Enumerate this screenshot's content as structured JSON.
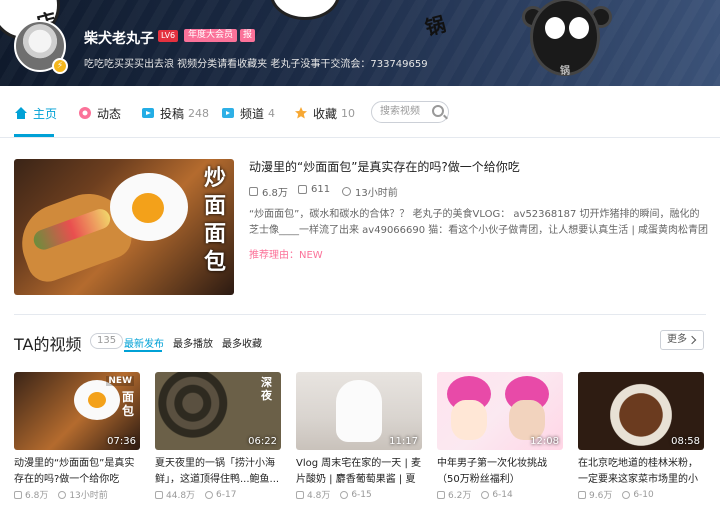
{
  "profile": {
    "username": "柴犬老丸子",
    "level": "LV6",
    "vip_badge": "年度大会员",
    "extra_badge": "报",
    "signature": "吃吃吃买买买出去浪 视频分类请看收藏夹 老丸子没事干交流会：733749659"
  },
  "banner": {
    "glyph_left": "店",
    "glyph_mid": "锅",
    "glyph_right": "锅"
  },
  "nav": {
    "home": "主页",
    "dynamic": "动态",
    "submissions": "投稿",
    "submissions_count": "248",
    "channels": "频道",
    "channels_count": "4",
    "favorites": "收藏",
    "favorites_count": "10",
    "search_placeholder": "搜索视频"
  },
  "featured": {
    "cover_text": "炒面面包",
    "title": "动漫里的“炒面面包”是真实存在的吗?做一个给你吃",
    "plays": "6.8万",
    "comments": "611",
    "time": "13小时前",
    "description": "“炒面面包”，碳水和碳水的合体？？ 老丸子的美食VLOG： av52368187 切开炸猪排的瞬间，融化的芝士像____一样流了出来 av49066690 猫：看这个小伙子做青团，让人想要认真生活 | 咸蛋黄肉松青团",
    "reason": "推荐理由：NEW"
  },
  "videos_section": {
    "title": "TA的视频",
    "count": "135",
    "sort_new": "最新发布",
    "sort_hot": "最多播放",
    "sort_fav": "最多收藏",
    "more": "更多"
  },
  "videos": [
    {
      "title": "动漫里的“炒面面包”是真实存在的吗?做一个给你吃",
      "duration": "07:36",
      "plays": "6.8万",
      "time": "13小时前",
      "badge": "NEW",
      "cover_text": "面包"
    },
    {
      "title": "夏天夜里的一锅「捞汁小海鲜」，这道顶得住鸭...鲍鱼...",
      "duration": "06:22",
      "plays": "44.8万",
      "time": "6-17",
      "cover_text": "深夜"
    },
    {
      "title": "Vlog 周末宅在家的一天 | 麦片酸奶 | 麝香葡萄果酱 | 夏天 |",
      "duration": "11:17",
      "plays": "4.8万",
      "time": "6-15"
    },
    {
      "title": "中年男子第一次化妆挑战（50万粉丝福利）",
      "duration": "12:08",
      "plays": "6.2万",
      "time": "6-14"
    },
    {
      "title": "在北京吃地道的桂林米粉，一定要来这家菜市场里的小破店",
      "duration": "08:58",
      "plays": "9.6万",
      "time": "6-10"
    }
  ],
  "colors": {
    "accent": "#00a1d6",
    "pink": "#fb7299",
    "level_red": "#e4313f"
  }
}
